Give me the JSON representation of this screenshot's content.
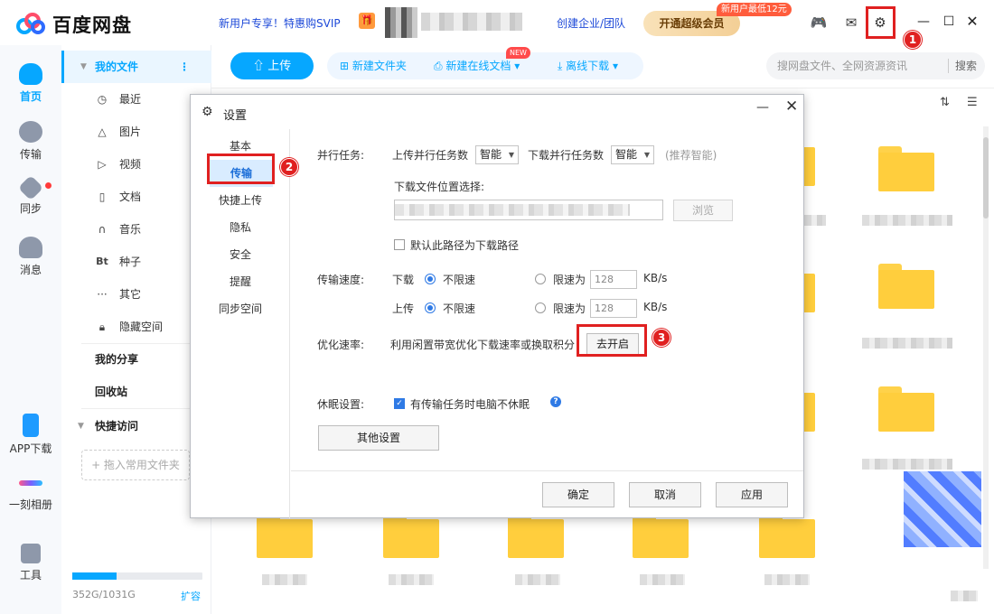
{
  "app": {
    "name": "百度网盘",
    "promo_text": "新用户专享！特惠购SVIP",
    "enterprise_link": "创建企业/团队",
    "vip_button": "开通超级会员",
    "vip_badge": "新用户最低12元"
  },
  "rail": {
    "items": [
      {
        "label": "首页",
        "icon": "home-cloud-icon"
      },
      {
        "label": "传输",
        "icon": "transfer-icon"
      },
      {
        "label": "同步",
        "icon": "sync-icon"
      },
      {
        "label": "消息",
        "icon": "message-icon"
      },
      {
        "label": "APP下载",
        "icon": "phone-icon"
      },
      {
        "label": "一刻相册",
        "icon": "album-icon"
      },
      {
        "label": "工具",
        "icon": "tools-icon"
      }
    ]
  },
  "sidebar": {
    "my_files": "我的文件",
    "items": [
      {
        "label": "最近",
        "icon": "clock-icon"
      },
      {
        "label": "图片",
        "icon": "image-icon"
      },
      {
        "label": "视频",
        "icon": "video-icon"
      },
      {
        "label": "文档",
        "icon": "document-icon"
      },
      {
        "label": "音乐",
        "icon": "headphone-icon"
      },
      {
        "label": "种子",
        "icon": "bt-icon"
      },
      {
        "label": "其它",
        "icon": "more-icon"
      },
      {
        "label": "隐藏空间",
        "icon": "lock-icon"
      }
    ],
    "my_share": "我的分享",
    "recycle": "回收站",
    "quick_access": "快捷访问",
    "drop_hint": "+ 拖入常用文件夹",
    "storage_text": "352G/1031G",
    "storage_used_fraction": 0.341,
    "expand": "扩容"
  },
  "toolbar": {
    "upload": "上传",
    "new_folder": "新建文件夹",
    "new_online_doc": "新建在线文档",
    "new_badge": "NEW",
    "offline_download": "离线下载",
    "search_placeholder": "搜网盘文件、全网资源资讯",
    "search_button": "搜索"
  },
  "dialog": {
    "title": "设置",
    "nav": [
      "基本",
      "传输",
      "快捷上传",
      "隐私",
      "安全",
      "提醒",
      "同步空间"
    ],
    "active_nav": "传输",
    "parallel": {
      "label": "并行任务:",
      "upload_label": "上传并行任务数",
      "upload_value": "智能",
      "download_label": "下载并行任务数",
      "download_value": "智能",
      "hint": "(推荐智能)"
    },
    "download_location_label": "下载文件位置选择:",
    "browse": "浏览",
    "default_path_label": "默认此路径为下载路径",
    "speed": {
      "label": "传输速度:",
      "download": "下载",
      "upload": "上传",
      "unlimited": "不限速",
      "limit": "限速为",
      "download_limit": "128",
      "upload_limit": "128",
      "unit": "KB/s"
    },
    "optimize": {
      "label": "优化速率:",
      "text": "利用闲置带宽优化下载速率或换取积分",
      "button": "去开启"
    },
    "sleep": {
      "label": "休眠设置:",
      "checkbox": "有传输任务时电脑不休眠"
    },
    "other_settings": "其他设置",
    "footer": {
      "ok": "确定",
      "cancel": "取消",
      "apply": "应用"
    }
  },
  "annotations": [
    "1",
    "2",
    "3"
  ],
  "colors": {
    "accent": "#06a7ff",
    "annotation": "#e02020",
    "folder": "#ffce3d"
  }
}
